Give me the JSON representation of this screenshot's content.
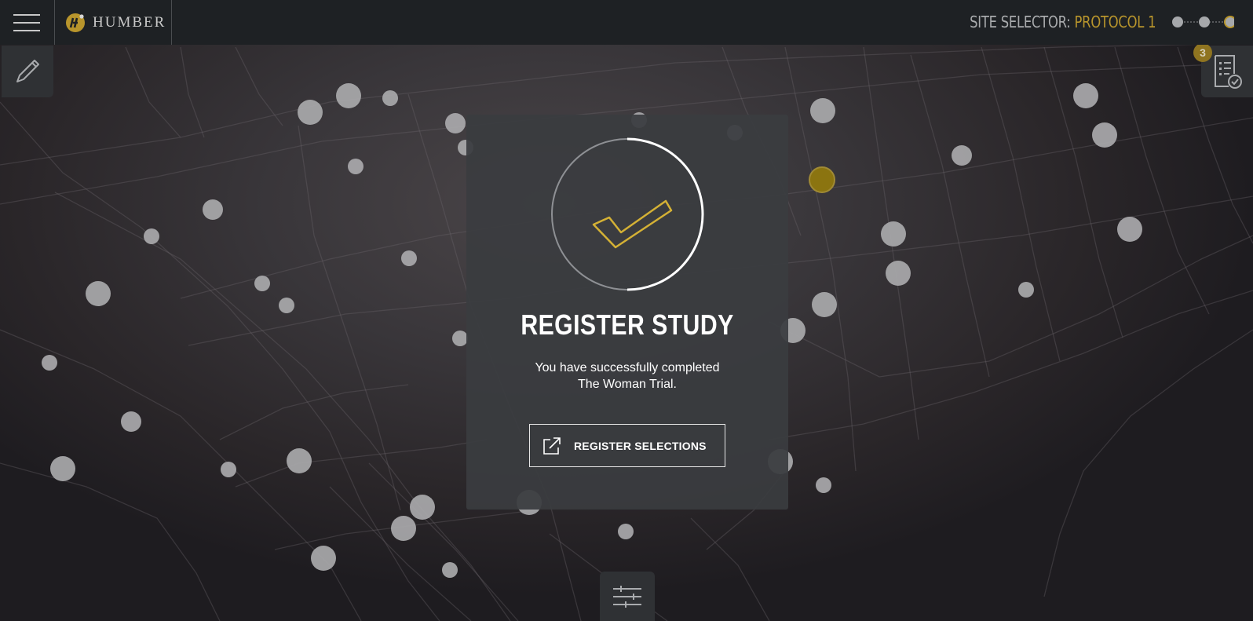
{
  "header": {
    "menu_icon": "hamburger-icon",
    "logo_text": "HUMBER",
    "site_selector_label": "SITE SELECTOR:",
    "site_selector_value": "PROTOCOL 1",
    "stepper_total": 3,
    "stepper_current": 3
  },
  "tools": {
    "edit_icon": "pencil-icon",
    "checklist_icon": "checklist-icon",
    "checklist_badge": "3",
    "filter_icon": "sliders-icon"
  },
  "modal": {
    "status_icon": "checkmark-icon",
    "title": "REGISTER STUDY",
    "message_line1": "You have successfully completed",
    "message_line2": "The Woman Trial.",
    "button_label": "REGISTER SELECTIONS",
    "button_icon": "external-link-icon"
  },
  "colors": {
    "accent": "#b8952c",
    "topbar": "#1e2124",
    "panel": "#3a3c40",
    "marker": "#a9a9ab",
    "marker_selected": "#8b7410"
  }
}
